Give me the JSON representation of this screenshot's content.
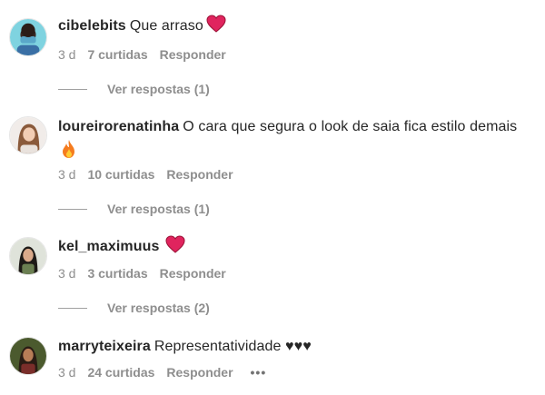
{
  "comments": [
    {
      "username": "cibelebits",
      "text": "Que arraso",
      "emoji": "red-heart",
      "time": "3 d",
      "likes": "7 curtidas",
      "reply": "Responder",
      "view_replies": "Ver respostas (1)"
    },
    {
      "username": "loureirorenatinha",
      "text": "O cara que segura o look de saia fica estilo demais",
      "emoji": "fire",
      "time": "3 d",
      "likes": "10 curtidas",
      "reply": "Responder",
      "view_replies": "Ver respostas (1)"
    },
    {
      "username": "kel_maximuus",
      "text": "",
      "emoji": "red-heart",
      "time": "3 d",
      "likes": "3 curtidas",
      "reply": "Responder",
      "view_replies": "Ver respostas (2)"
    },
    {
      "username": "marryteixeira",
      "text": "Representatividade ♥♥♥",
      "time": "3 d",
      "likes": "24 curtidas",
      "reply": "Responder",
      "more": "•••"
    }
  ],
  "colors": {
    "heart": "#e0245e",
    "muted": "#8e8e8e",
    "text": "#262626"
  }
}
